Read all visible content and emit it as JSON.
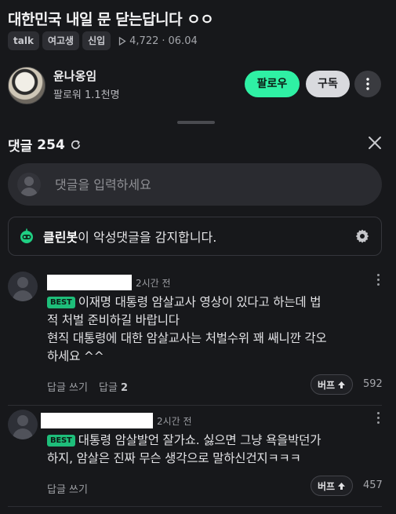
{
  "post": {
    "title": "대한민국 내일 문 닫는답니다 ㅇㅇ",
    "tags": [
      "talk",
      "여고생",
      "신입"
    ],
    "views": "4,722",
    "date": "06.04"
  },
  "author": {
    "name": "윤나옹임",
    "followers": "팔로워 1.1천명",
    "follow_label": "팔로우",
    "subscribe_label": "구독"
  },
  "comments_header": {
    "label": "댓글",
    "count": "254"
  },
  "comment_input": {
    "placeholder": "댓글을 입력하세요"
  },
  "cleanbot": {
    "name": "클린봇",
    "message": "이 악성댓글을 감지합니다."
  },
  "comments": [
    {
      "time": "2시간 전",
      "badge": "BEST",
      "text_line1": "이재명 대통령 암살교사 영상이 있다고 하는데 법",
      "text_line2": "적 처벌 준비하길 바랍니다",
      "text_line3": "현직 대통령에 대한 암살교사는 처벌수위 꽤 쌔니깐 각오",
      "text_line4": "하세요 ^^",
      "reply_write": "답글 쓰기",
      "reply_label": "답글",
      "reply_count": "2",
      "buff_label": "버프",
      "buff_count": "592"
    },
    {
      "time": "2시간 전",
      "badge": "BEST",
      "text_line1": "대통령 암살발언 잘가쇼. 싫으면 그냥 욕을박던가",
      "text_line2": "하지, 암살은 진짜 무슨 생각으로 말하신건지ㅋㅋㅋ",
      "reply_write": "답글 쓰기",
      "buff_label": "버프",
      "buff_count": "457"
    }
  ],
  "colors": {
    "background": "#17181b",
    "accent_green": "#2ff0a4",
    "best_badge": "#1ebe7a"
  }
}
